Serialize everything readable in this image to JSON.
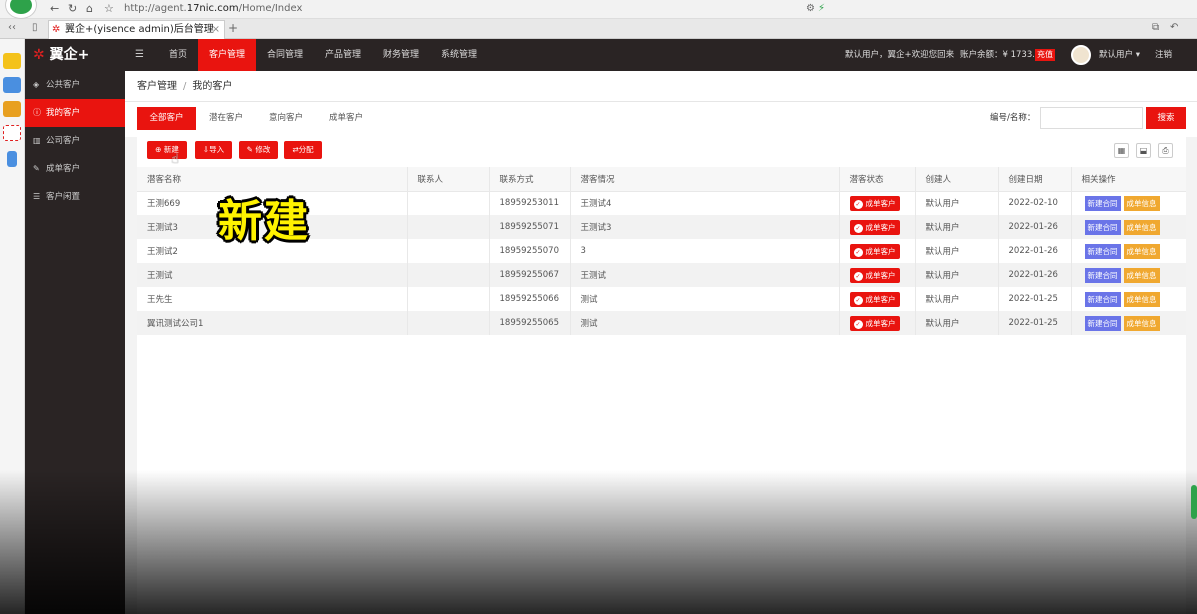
{
  "browser": {
    "url_prefix": "http://agent.",
    "url_domain": "17nic.com",
    "url_path": "/Home/Index",
    "tab_title": "翼企+(yisence admin)后台管理",
    "tab_close": "×",
    "tab_new": "+"
  },
  "app": {
    "logo_text": "翼企+",
    "nav": [
      "首页",
      "客户管理",
      "合同管理",
      "产品管理",
      "财务管理",
      "系统管理"
    ],
    "active_nav": "客户管理",
    "welcome": "默认用户，翼企+欢迎您回来",
    "balance": "账户余额：¥ 1733.06",
    "recharge": "充值",
    "user": "默认用户 ▾",
    "logout": "注销"
  },
  "sidebar": {
    "items": [
      {
        "label": "公共客户",
        "icon": "cube-icon"
      },
      {
        "label": "我的客户",
        "icon": "info-icon"
      },
      {
        "label": "公司客户",
        "icon": "bar-chart-icon"
      },
      {
        "label": "成单客户",
        "icon": "edit-icon"
      },
      {
        "label": "客户闲置",
        "icon": "sliders-icon"
      }
    ],
    "active": "我的客户"
  },
  "breadcrumb": {
    "parent": "客户管理",
    "sep": "/",
    "current": "我的客户"
  },
  "customer_tabs": [
    "全部客户",
    "潜在客户",
    "意向客户",
    "成单客户"
  ],
  "search": {
    "label": "编号/名称：",
    "button": "搜索",
    "value": ""
  },
  "toolbar": {
    "new": "新建",
    "import": "导入",
    "edit": "修改",
    "assign": "分配"
  },
  "table": {
    "headers": [
      "潜客名称",
      "联系人",
      "联系方式",
      "潜客情况",
      "潜客状态",
      "创建人",
      "创建日期",
      "相关操作"
    ],
    "rows": [
      {
        "name": "王测669",
        "contact": "",
        "phone": "18959253011",
        "situation": "王测试4",
        "status": "成单客户",
        "creator": "默认用户",
        "date": "2022-02-10"
      },
      {
        "name": "王测试3",
        "contact": "",
        "phone": "18959255071",
        "situation": "王测试3",
        "status": "成单客户",
        "creator": "默认用户",
        "date": "2022-01-26"
      },
      {
        "name": "王测试2",
        "contact": "",
        "phone": "18959255070",
        "situation": "3",
        "status": "成单客户",
        "creator": "默认用户",
        "date": "2022-01-26"
      },
      {
        "name": "王测试",
        "contact": "",
        "phone": "18959255067",
        "situation": "王测试",
        "status": "成单客户",
        "creator": "默认用户",
        "date": "2022-01-26"
      },
      {
        "name": "王先生",
        "contact": "",
        "phone": "18959255066",
        "situation": "测试",
        "status": "成单客户",
        "creator": "默认用户",
        "date": "2022-01-25"
      },
      {
        "name": "翼讯测试公司1",
        "contact": "",
        "phone": "18959255065",
        "situation": "测试",
        "status": "成单客户",
        "creator": "默认用户",
        "date": "2022-01-25"
      }
    ],
    "action_contract": "新建合同",
    "action_order": "成单信息"
  },
  "caption": "新建",
  "colors": {
    "accent": "#e9140f",
    "dark": "#2a2424",
    "blue_action": "#6a74e8",
    "orange_action": "#f0a830",
    "caption": "#fff200"
  }
}
